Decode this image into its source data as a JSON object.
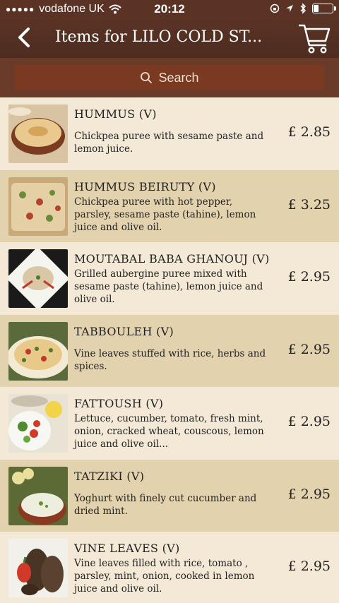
{
  "status_bar": {
    "carrier": "vodafone UK",
    "time": "20:12"
  },
  "header": {
    "title": "Items for LILO COLD ST..."
  },
  "search": {
    "label": "Search"
  },
  "items": [
    {
      "name": "HUMMUS (V)",
      "description": "Chickpea puree with sesame paste and lemon juice.",
      "price": "£ 2.85"
    },
    {
      "name": "HUMMUS BEIRUTY (V)",
      "description": "Chickpea puree with hot pepper, parsley, sesame paste (tahine), lemon juice and olive oil.",
      "price": "£ 3.25"
    },
    {
      "name": "MOUTABAL BABA GHANOUJ (V)",
      "description": "Grilled aubergine puree mixed with sesame paste (tahine), lemon juice and olive oil.",
      "price": "£ 2.95"
    },
    {
      "name": "TABBOULEH (V)",
      "description": "Vine leaves stuffed with rice, herbs and spices.",
      "price": "£ 2.95"
    },
    {
      "name": "FATTOUSH (V)",
      "description": "Lettuce, cucumber, tomato, fresh mint, onion, cracked wheat, couscous, lemon juice and olive oil...",
      "price": "£ 2.95"
    },
    {
      "name": "TATZIKI (V)",
      "description": "Yoghurt with finely cut cucumber and dried mint.",
      "price": "£ 2.95"
    },
    {
      "name": "VINE LEAVES (V)",
      "description": "Vine leaves filled with rice, tomato , parsley, mint, onion, cooked in lemon juice and olive oil.",
      "price": "£ 2.95"
    }
  ]
}
